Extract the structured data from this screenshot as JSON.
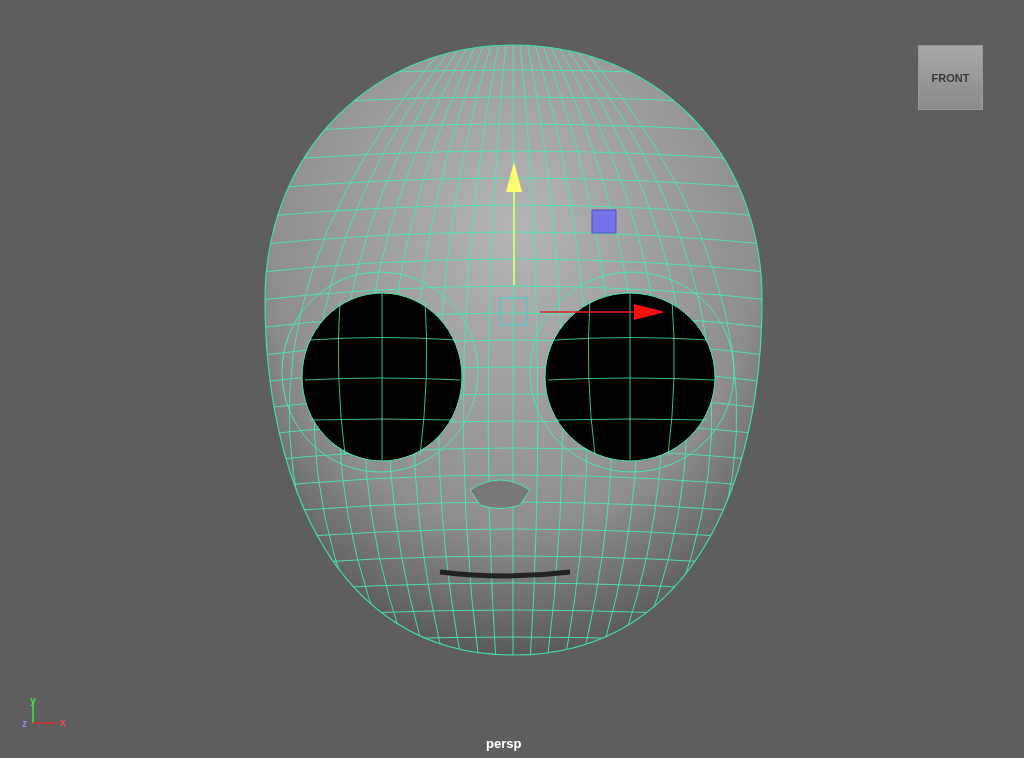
{
  "viewport": {
    "camera_label": "persp",
    "view_cube": {
      "face_label": "FRONT"
    },
    "axis_gizmo": {
      "y_label": "y",
      "z_label": "z",
      "x_label": "x"
    }
  }
}
